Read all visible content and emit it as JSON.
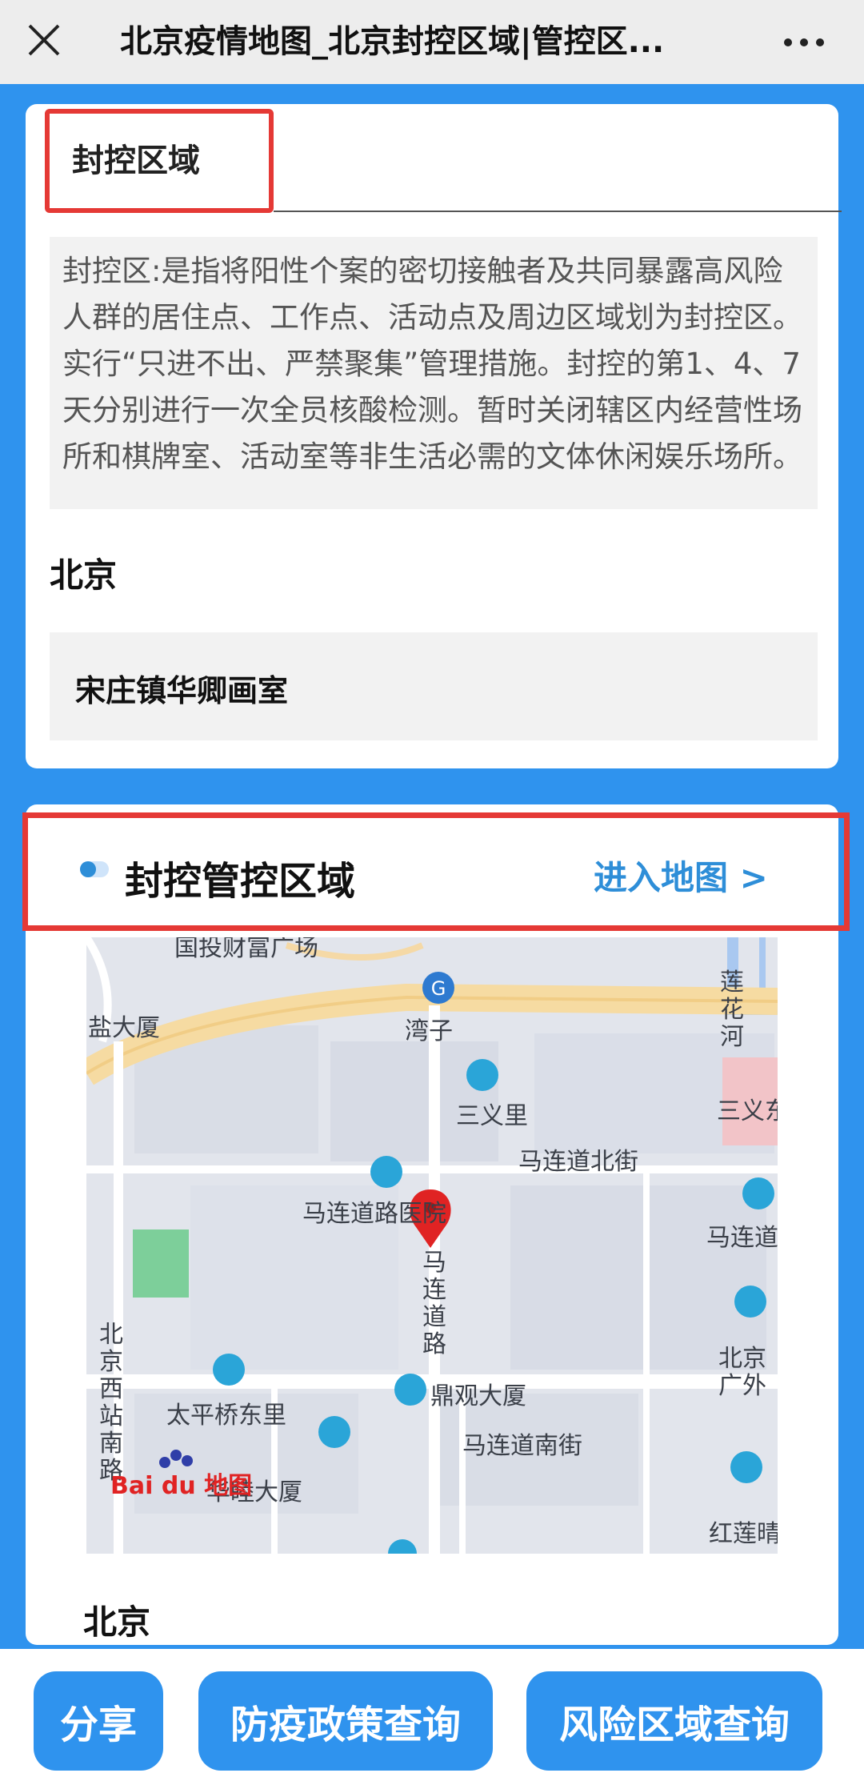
{
  "topbar": {
    "title": "北京疫情地图_北京封控区域|管控区..."
  },
  "zone_card": {
    "heading": "封控区域",
    "description": "封控区:是指将阳性个案的密切接触者及共同暴露高风险人群的居住点、工作点、活动点及周边区域划为封控区。实行“只进不出、严禁聚集”管理措施。封控的第1、4、7天分别进行一次全员核酸检测。暂时关闭辖区内经营性场所和棋牌室、活动室等非生活必需的文体休闲娱乐场所。",
    "city": "北京",
    "items": [
      "宋庄镇华卿画室"
    ]
  },
  "map_card": {
    "heading": "封控管控区域",
    "enter_map": "进入地图 >",
    "city": "北京",
    "map_labels": {
      "guotou": "国投财富广场",
      "yan_dasha": "盐大厦",
      "wanzi": "湾子",
      "lianhuahe": "莲花河",
      "sanyili": "三义里",
      "sanyi_dong": "三义东",
      "malian_bei": "马连道北街",
      "malian_yiyuan": "马连道路医院",
      "malian_road": "马连道路",
      "malian_right": "马连道",
      "beijing_xizhan_nanlu": "北京西站南路",
      "taipingqiao": "太平桥东里",
      "dingguan": "鼎观大厦",
      "beijing_guangwai": "北京广外",
      "malian_nan": "马连道南街",
      "huamu_dasha": "华睦大厦",
      "hongliang": "红莲晴",
      "logo": "Bai du 地图"
    }
  },
  "bottom_buttons": {
    "share": "分享",
    "policy": "防疫政策查询",
    "risk": "风险区域查询"
  }
}
